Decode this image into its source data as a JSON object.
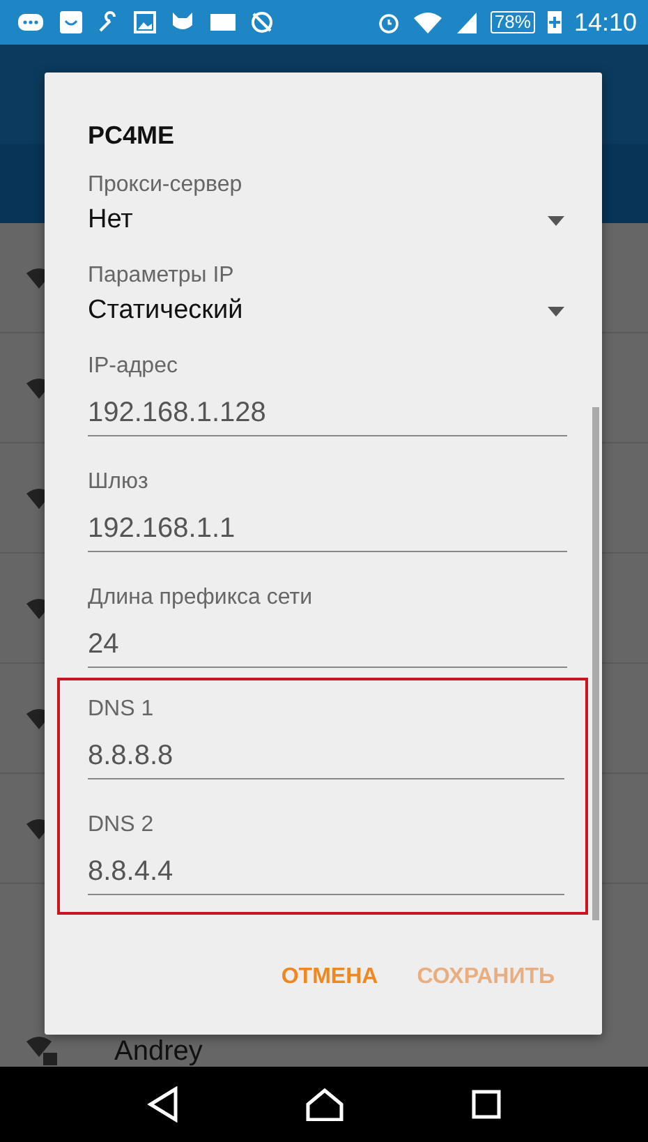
{
  "status_bar": {
    "battery": "78%",
    "time": "14:10"
  },
  "background": {
    "networks": [
      {
        "name": "Andrey"
      }
    ]
  },
  "dialog": {
    "title": "PC4ME",
    "dropdowns": [
      {
        "label": "Прокси-сервер",
        "value": "Нет"
      },
      {
        "label": "Параметры IP",
        "value": "Статический"
      }
    ],
    "fields": [
      {
        "label": "IP-адрес",
        "value": "192.168.1.128"
      },
      {
        "label": "Шлюз",
        "value": "192.168.1.1"
      },
      {
        "label": "Длина префикса сети",
        "value": "24"
      }
    ],
    "highlighted_fields": [
      {
        "label": "DNS 1",
        "value": "8.8.8.8"
      },
      {
        "label": "DNS 2",
        "value": "8.8.4.4"
      }
    ],
    "buttons": [
      {
        "label": "ОТМЕНА",
        "disabled": false
      },
      {
        "label": "СОХРАНИТЬ",
        "disabled": true
      }
    ]
  }
}
